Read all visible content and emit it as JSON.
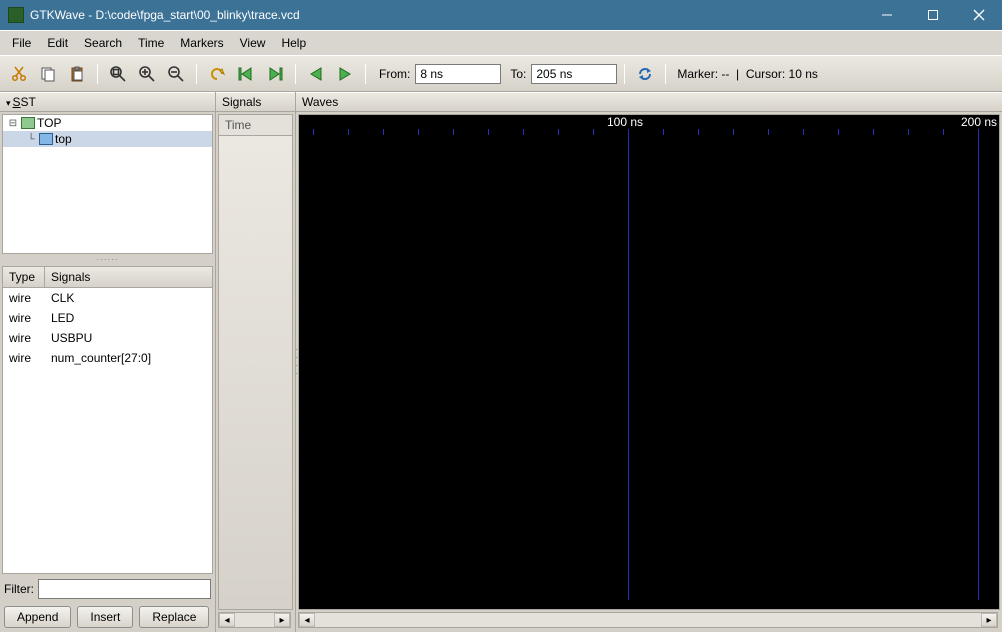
{
  "window": {
    "title": "GTKWave - D:\\code\\fpga_start\\00_blinky\\trace.vcd"
  },
  "menu": [
    "File",
    "Edit",
    "Search",
    "Time",
    "Markers",
    "View",
    "Help"
  ],
  "toolbar": {
    "from_label": "From:",
    "from_value": "8 ns",
    "to_label": "To:",
    "to_value": "205 ns",
    "marker_label": "Marker:",
    "marker_value": "--",
    "cursor_label": "Cursor:",
    "cursor_value": "10 ns"
  },
  "sst": {
    "heading": "SST",
    "items": [
      {
        "name": "TOP",
        "label": "TOP",
        "indent": 0,
        "selected": false,
        "expanded": true
      },
      {
        "name": "top",
        "label": "top",
        "indent": 1,
        "selected": true,
        "expanded": false
      }
    ]
  },
  "signals_table": {
    "col_type": "Type",
    "col_signals": "Signals",
    "rows": [
      {
        "type": "wire",
        "name": "CLK"
      },
      {
        "type": "wire",
        "name": "LED"
      },
      {
        "type": "wire",
        "name": "USBPU"
      },
      {
        "type": "wire",
        "name": "num_counter[27:0]"
      }
    ]
  },
  "filter": {
    "label": "Filter:",
    "value": ""
  },
  "buttons": {
    "append": "Append",
    "insert": "Insert",
    "replace": "Replace"
  },
  "mid": {
    "heading": "Signals",
    "time_label": "Time"
  },
  "waves": {
    "heading": "Waves",
    "tick1": "100 ns",
    "tick2": "200 ns"
  }
}
